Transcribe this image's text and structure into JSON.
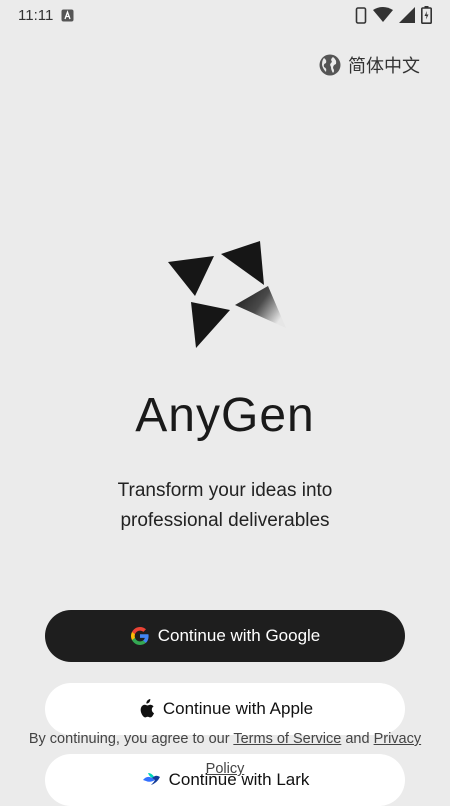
{
  "status_bar": {
    "time": "11:11"
  },
  "language_switch": {
    "label": "简体中文",
    "icon": "globe-icon"
  },
  "app": {
    "name": "AnyGen",
    "tagline_line1": "Transform your ideas into",
    "tagline_line2": "professional deliverables"
  },
  "buttons": {
    "google": "Continue with Google",
    "apple": "Continue with Apple",
    "lark": "Continue with Lark"
  },
  "terms": {
    "prefix": "By continuing, you agree to our ",
    "terms_link": "Terms of Service",
    "middle": " and ",
    "privacy_link_part1": "Privacy",
    "privacy_link_part2": "Policy"
  },
  "colors": {
    "background": "#ebebeb",
    "primary_button": "#1e1e1e",
    "secondary_button": "#ffffff"
  }
}
